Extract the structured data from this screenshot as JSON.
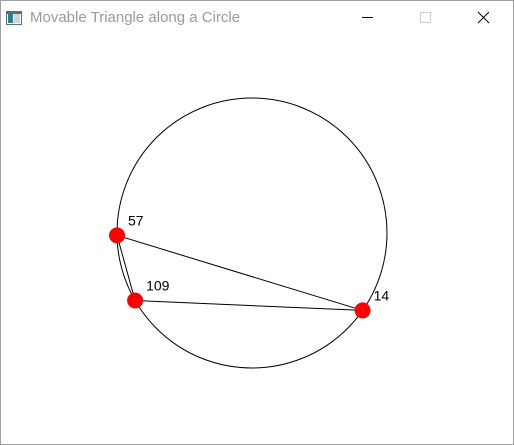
{
  "window": {
    "title": "Movable Triangle along a Circle"
  },
  "icons": {
    "app": "window-app-icon",
    "minimize": "minimize-icon",
    "maximize": "maximize-icon",
    "close": "close-icon"
  },
  "colors": {
    "vertex": "#ff0000",
    "stroke": "#000000",
    "title_text": "#9a9a9a"
  },
  "vertices": [
    {
      "label": "57",
      "angle_deg": 181
    },
    {
      "label": "109",
      "angle_deg": 210
    },
    {
      "label": "14",
      "angle_deg": 325
    }
  ]
}
